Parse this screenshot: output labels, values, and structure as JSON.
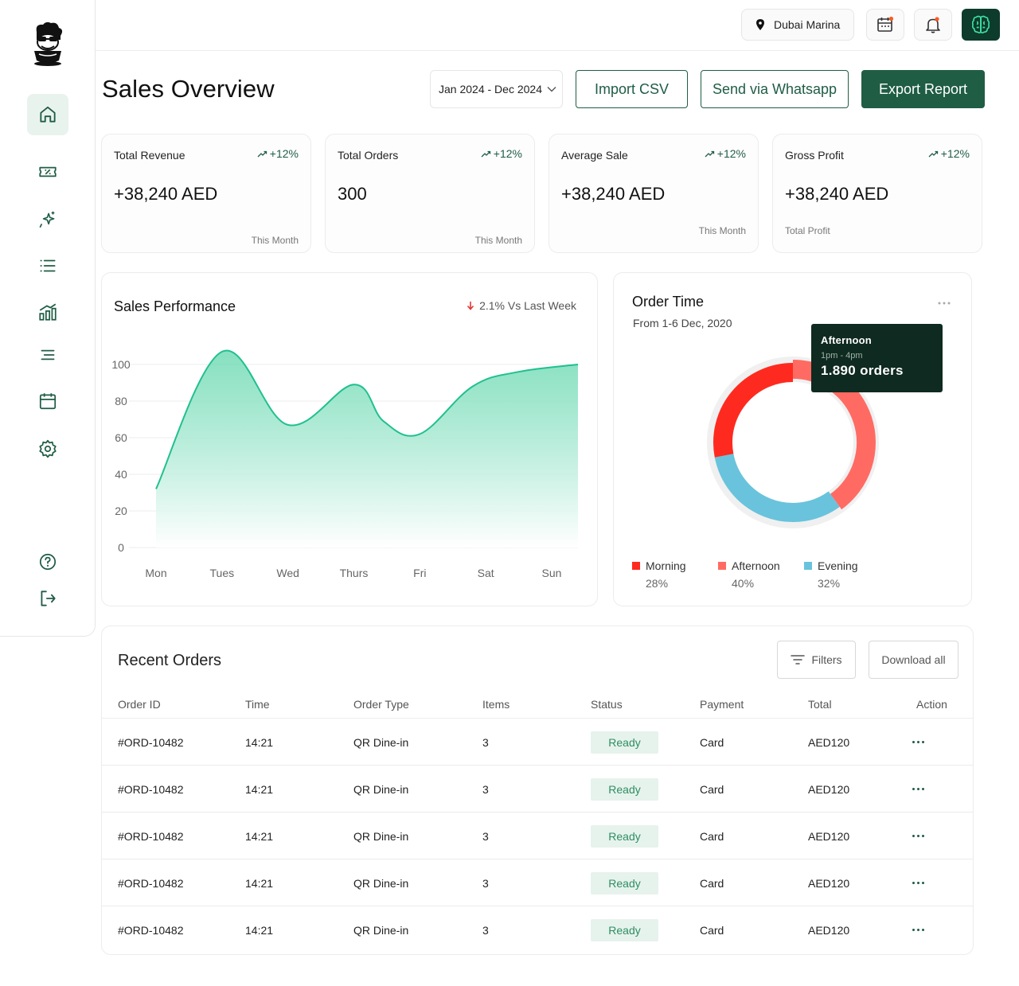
{
  "topbar": {
    "location": "Dubai Marina"
  },
  "header": {
    "title": "Sales Overview",
    "date_range": "Jan 2024 - Dec 2024",
    "import_label": "Import CSV",
    "whatsapp_label": "Send via Whatsapp",
    "export_label": "Export Report"
  },
  "stats": [
    {
      "label": "Total Revenue",
      "delta": "+12%",
      "value": "+38,240 AED",
      "foot": "This Month"
    },
    {
      "label": "Total Orders",
      "delta": "+12%",
      "value": "300",
      "foot": "This Month"
    },
    {
      "label": "Average Sale",
      "delta": "+12%",
      "value": "+38,240 AED",
      "foot": "This Month"
    },
    {
      "label": "Gross Profit",
      "delta": "+12%",
      "value": "+38,240 AED",
      "foot": "Total Profit"
    }
  ],
  "sales_performance": {
    "title": "Sales Performance",
    "delta": "2.1% Vs Last Week"
  },
  "order_time": {
    "title": "Order Time",
    "subtitle": "From 1-6 Dec, 2020",
    "tooltip": {
      "title": "Afternoon",
      "time": "1pm - 4pm",
      "value": "1.890 orders"
    },
    "legend": [
      {
        "name": "Morning",
        "pct": "28%",
        "color": "#ff2a1f"
      },
      {
        "name": "Afternoon",
        "pct": "40%",
        "color": "#ff6b63"
      },
      {
        "name": "Evening",
        "pct": "32%",
        "color": "#69c3dc"
      }
    ]
  },
  "chart_data": [
    {
      "type": "area",
      "title": "Sales Performance",
      "categories": [
        "Mon",
        "Tues",
        "Wed",
        "Thurs",
        "Fri",
        "Sat",
        "Sun"
      ],
      "yticks": [
        "0",
        "20",
        "40",
        "60",
        "80",
        "100"
      ],
      "ylim": [
        0,
        100
      ],
      "points": [
        {
          "x": 0.0,
          "y": 32
        },
        {
          "x": 1.0,
          "y": 107
        },
        {
          "x": 2.0,
          "y": 67
        },
        {
          "x": 3.0,
          "y": 89
        },
        {
          "x": 3.45,
          "y": 69
        },
        {
          "x": 4.0,
          "y": 62
        },
        {
          "x": 4.8,
          "y": 88
        },
        {
          "x": 5.5,
          "y": 96
        },
        {
          "x": 6.4,
          "y": 100
        }
      ],
      "grid": true,
      "color": "#20c08f"
    },
    {
      "type": "pie",
      "title": "Order Time",
      "categories": [
        "Morning",
        "Afternoon",
        "Evening"
      ],
      "values": [
        28,
        40,
        32
      ],
      "colors": [
        "#ff2a1f",
        "#ff6b63",
        "#69c3dc"
      ]
    }
  ],
  "orders": {
    "title": "Recent Orders",
    "filters_label": "Filters",
    "download_label": "Download all",
    "columns": [
      "Order ID",
      "Time",
      "Order Type",
      "Items",
      "Status",
      "Payment",
      "Total",
      "Action"
    ],
    "rows": [
      {
        "id": "#ORD-10482",
        "time": "14:21",
        "type": "QR Dine-in",
        "items": "3",
        "status": "Ready",
        "payment": "Card",
        "total": "AED120"
      },
      {
        "id": "#ORD-10482",
        "time": "14:21",
        "type": "QR Dine-in",
        "items": "3",
        "status": "Ready",
        "payment": "Card",
        "total": "AED120"
      },
      {
        "id": "#ORD-10482",
        "time": "14:21",
        "type": "QR Dine-in",
        "items": "3",
        "status": "Ready",
        "payment": "Card",
        "total": "AED120"
      },
      {
        "id": "#ORD-10482",
        "time": "14:21",
        "type": "QR Dine-in",
        "items": "3",
        "status": "Ready",
        "payment": "Card",
        "total": "AED120"
      },
      {
        "id": "#ORD-10482",
        "time": "14:21",
        "type": "QR Dine-in",
        "items": "3",
        "status": "Ready",
        "payment": "Card",
        "total": "AED120"
      }
    ]
  },
  "colors": {
    "brand": "#1f5d45",
    "brand_dark": "#0d3b2c",
    "accent_bg": "#e9f3ee"
  }
}
